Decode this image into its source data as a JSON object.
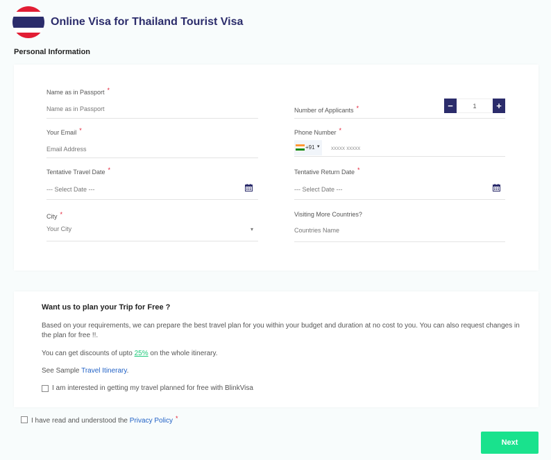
{
  "header": {
    "title": "Online Visa for Thailand Tourist Visa",
    "flag_icon": "thailand-flag"
  },
  "section": {
    "label": "Personal Information"
  },
  "form": {
    "name": {
      "label": "Name as in Passport",
      "required": "*",
      "placeholder": "Name as in Passport"
    },
    "applicants": {
      "label": "Number of Applicants",
      "required": "*",
      "value": "1",
      "minus": "−",
      "plus": "+"
    },
    "email": {
      "label": "Your Email",
      "required": "*",
      "placeholder": "Email Address"
    },
    "phone": {
      "label": "Phone Number",
      "required": "*",
      "code": "+91",
      "arrow": "▾",
      "placeholder": "xxxxx xxxxx"
    },
    "travel_date": {
      "label": "Tentative Travel Date",
      "required": "*",
      "placeholder": "--- Select Date ---"
    },
    "return_date": {
      "label": "Tentative Return Date",
      "required": "*",
      "placeholder": "--- Select Date ---"
    },
    "city": {
      "label": "City",
      "required": "*",
      "placeholder": "Your City",
      "arrow": "▾"
    },
    "countries": {
      "label": "Visiting More Countries?",
      "placeholder": "Countries Name"
    }
  },
  "plan": {
    "title": "Want us to plan your Trip for Free ?",
    "para1": "Based on your requirements, we can prepare the best travel plan for you within your budget and duration at no cost to you. You can also request changes in the plan for free !!.",
    "para2_prefix": "You can get discounts of upto ",
    "para2_percent": "25%",
    "para2_suffix": " on the whole itinerary.",
    "para3_prefix": "See Sample ",
    "para3_link": "Travel Itinerary",
    "para3_suffix": ".",
    "checkbox_label": "I am interested in getting my travel planned for free with BlinkVisa"
  },
  "terms": {
    "prefix": "I have read and understood the ",
    "link": "Privacy Policy",
    "required": "*"
  },
  "footer": {
    "next_label": "Next"
  },
  "colors": {
    "brand_navy": "#2b2c6b",
    "accent_green": "#19e28d",
    "required_red": "#e21d34",
    "link_blue": "#2262c6"
  }
}
